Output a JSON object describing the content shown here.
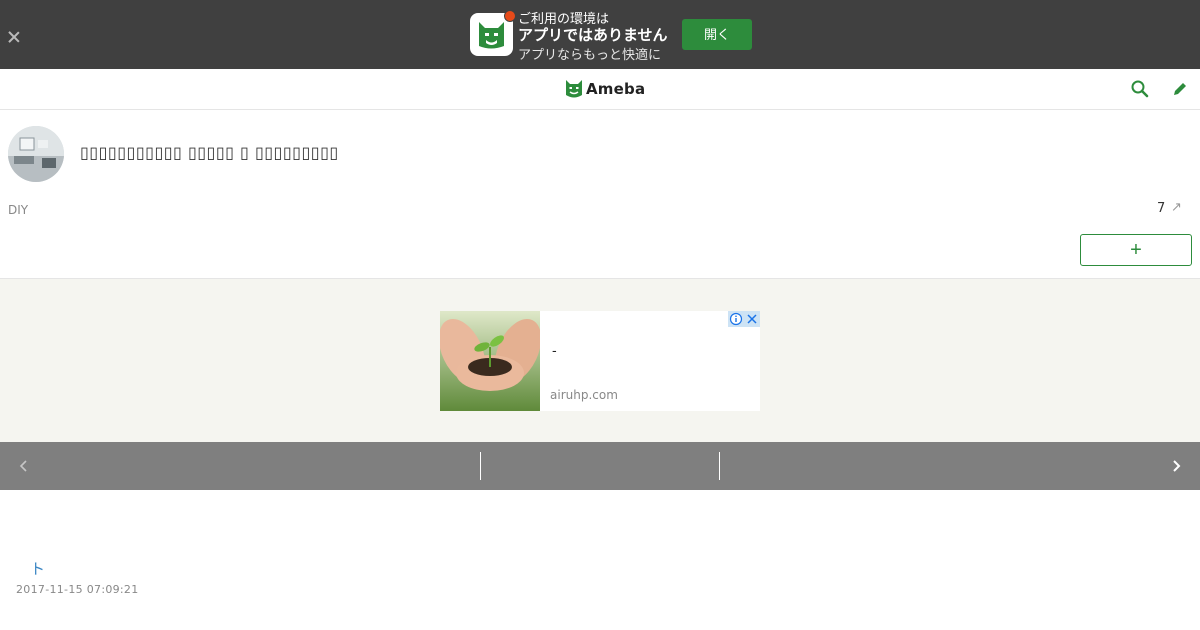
{
  "banner": {
    "line1": "ご利用の環境は",
    "line2": "アプリではありません",
    "line3": "アプリならもっと快適に",
    "open_label": "開く"
  },
  "header": {
    "logo_text": "Ameba",
    "icons": [
      "search-icon",
      "pencil-icon"
    ]
  },
  "blog": {
    "title": "▯▯▯▯▯▯▯▯▯▯▯ ▯▯▯▯▯ ▯ ▯▯▯▯▯▯▯▯▯",
    "genre": "DIY",
    "rank": "7",
    "rank_arrow": "↗",
    "follow_label": "+"
  },
  "ad": {
    "headline": "-",
    "domain": "airuhp.com",
    "info_icon": "ⓘ",
    "close_icon": "✕"
  },
  "entry": {
    "title": "ト",
    "date": "2017-11-15 07:09:21"
  },
  "colors": {
    "banner_bg": "#404040",
    "brand_green": "#2d8c3c",
    "nav_strip": "#7f7f7f",
    "link_blue": "#3b86c4"
  }
}
